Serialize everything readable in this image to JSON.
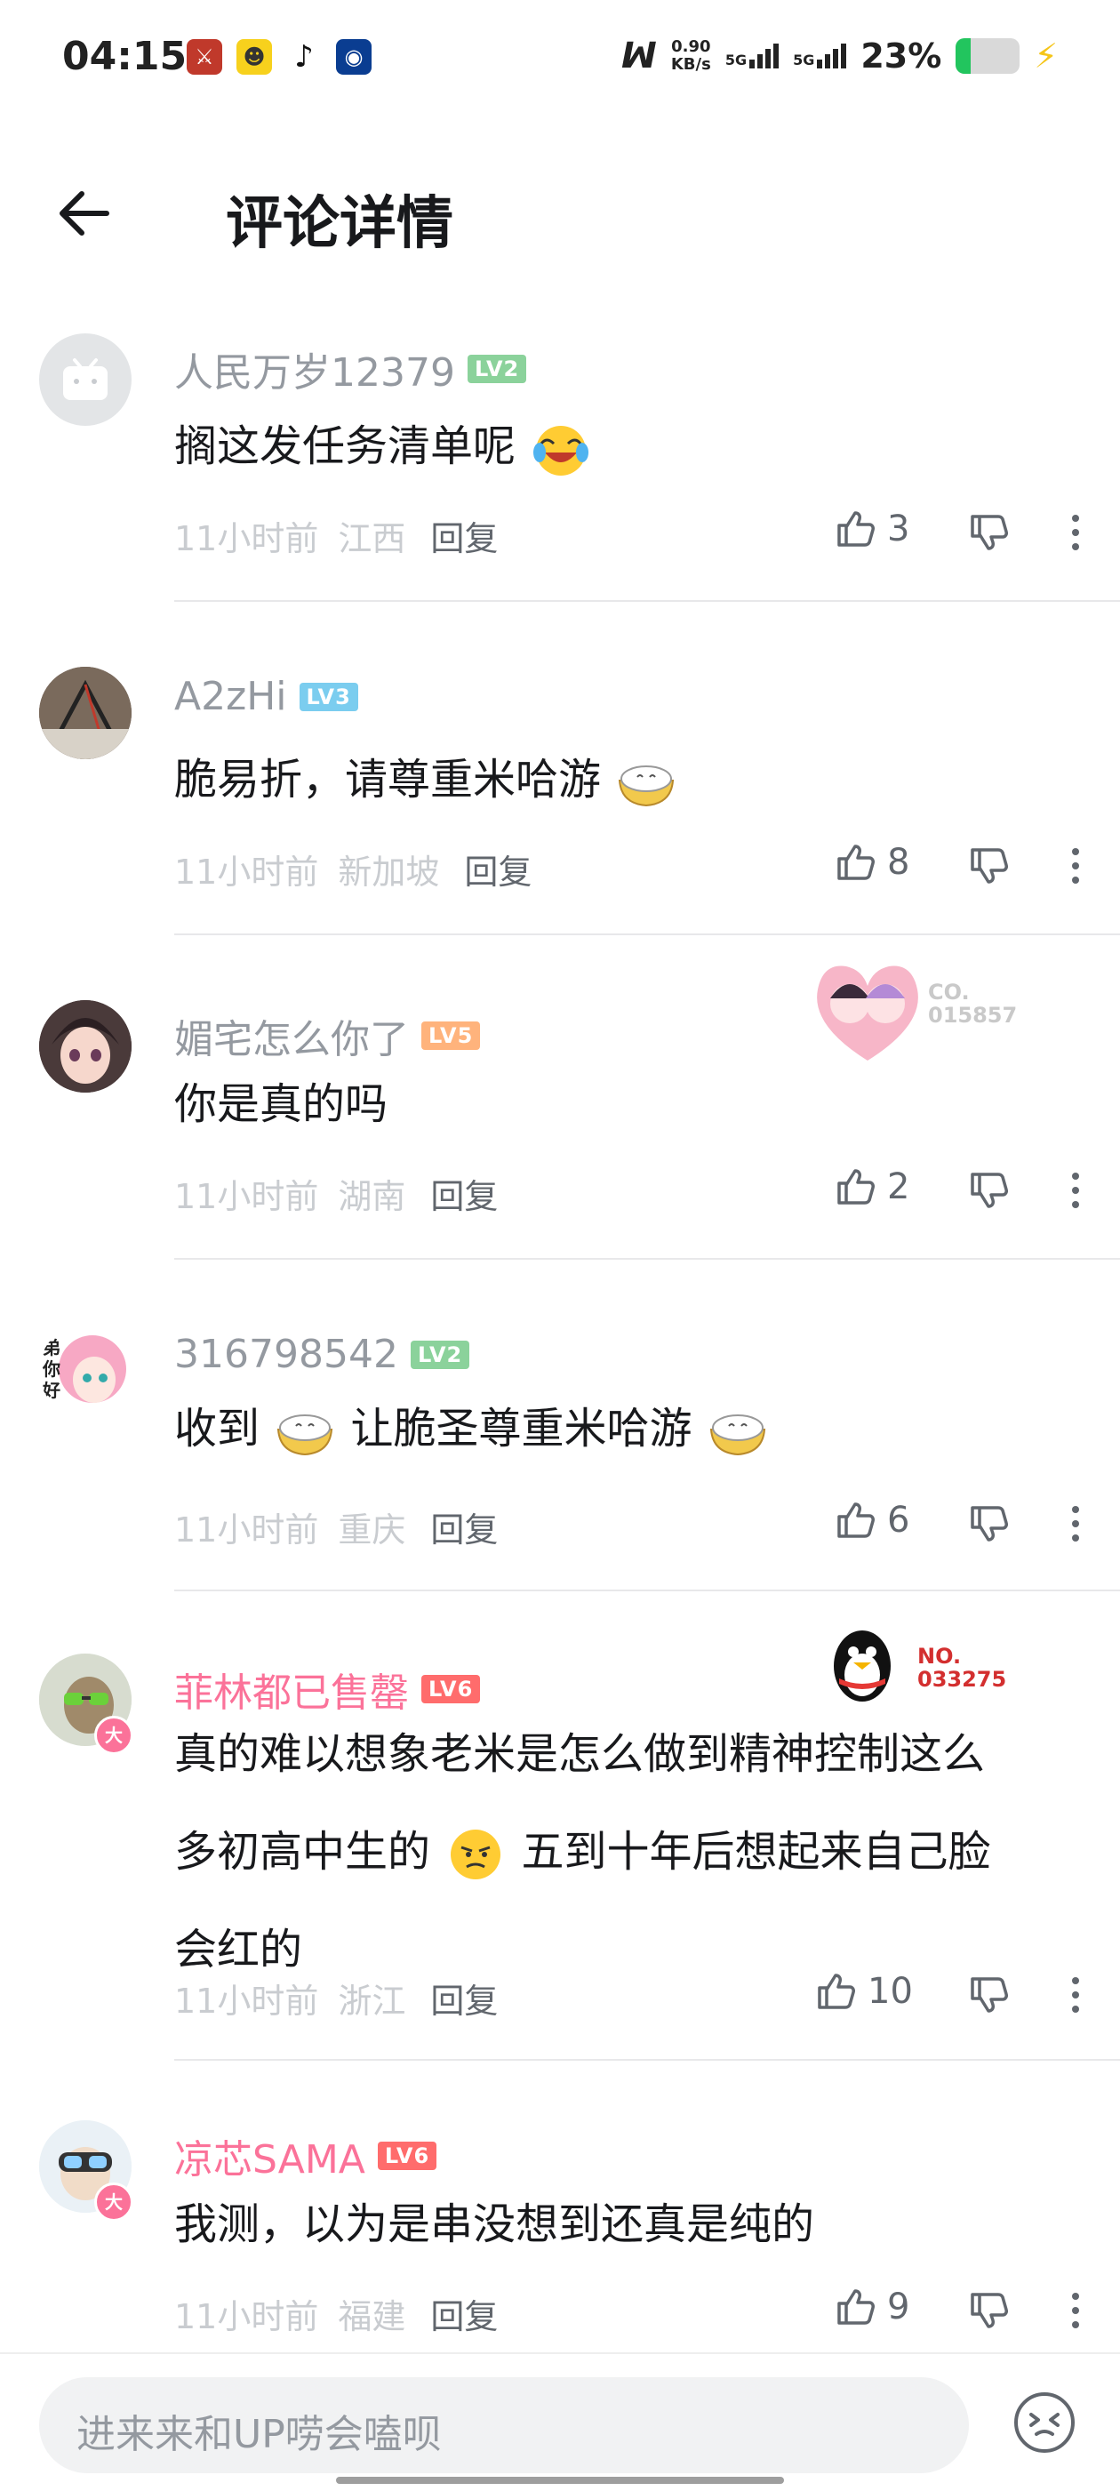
{
  "status_bar": {
    "time": "04:15",
    "net_speed_value": "0.90",
    "net_speed_unit": "KB/s",
    "signal1": "5G",
    "signal2": "5G",
    "battery": "23%",
    "battery_level": 0.23
  },
  "header": {
    "title": "评论详情"
  },
  "comments": [
    {
      "username": "人民万岁12379",
      "level": "LV2",
      "text": "搁这发任务清单呢",
      "time": "11小时前",
      "location": "江西",
      "reply_label": "回复",
      "likes": "3"
    },
    {
      "username": "A2zHi",
      "level": "LV3",
      "text": "脆易折，请尊重米哈游",
      "time": "11小时前",
      "location": "新加坡",
      "reply_label": "回复",
      "likes": "8"
    },
    {
      "username": "媚宅怎么你了",
      "level": "LV5",
      "text": "你是真的吗",
      "time": "11小时前",
      "location": "湖南",
      "reply_label": "回复",
      "likes": "2",
      "decor_no": "CO.",
      "decor_num": "015857"
    },
    {
      "username": "316798542",
      "level": "LV2",
      "text_part1": "收到",
      "text_part2": "让脆圣尊重米哈游",
      "time": "11小时前",
      "location": "重庆",
      "reply_label": "回复",
      "likes": "6",
      "avatar_text": "弟你好"
    },
    {
      "username": "菲林都已售罄",
      "level": "LV6",
      "text_line1": "真的难以想象老米是怎么做到精神控制这么",
      "text_line2a": "多初高中生的",
      "text_line2b": "五到十年后想起来自己脸",
      "text_line3": "会红的",
      "time": "11小时前",
      "location": "浙江",
      "reply_label": "回复",
      "likes": "10",
      "vip": "大",
      "decor_no": "NO.",
      "decor_num": "033275"
    },
    {
      "username": "凉芯SAMA",
      "level": "LV6",
      "text": "我测，以为是串没想到还真是纯的",
      "time": "11小时前",
      "location": "福建",
      "reply_label": "回复",
      "likes": "9",
      "vip": "大"
    }
  ],
  "bottom_bar": {
    "placeholder": "进来来和UP唠会嗑呗"
  },
  "colors": {
    "lv2": "#8bd29b",
    "lv3": "#7bcdef",
    "lv5": "#ffb37c",
    "lv6": "#ff6c6c",
    "pink": "#fb7299",
    "meta": "#c9ccd0"
  }
}
